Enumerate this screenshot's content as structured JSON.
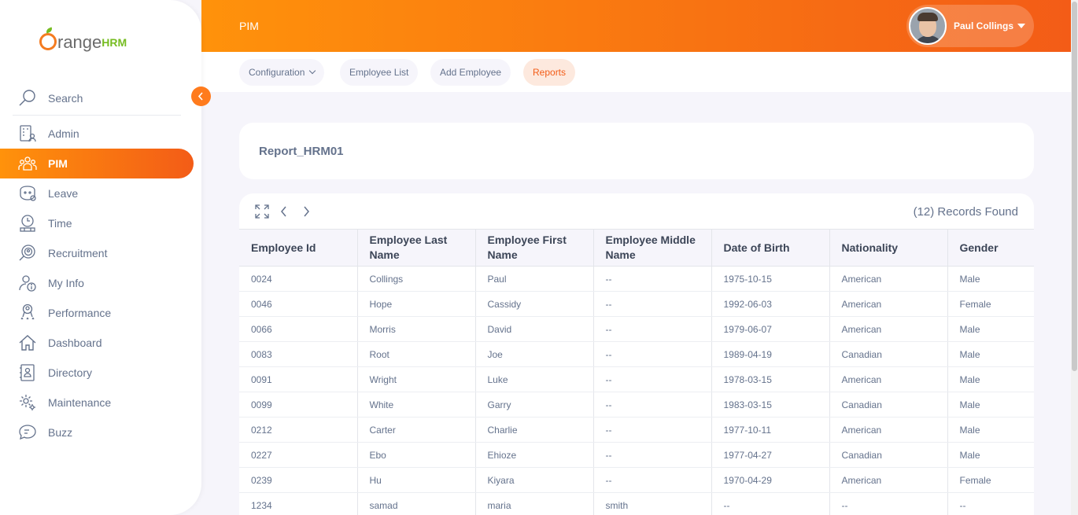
{
  "brand": {
    "part1": "range",
    "part2": "HRM"
  },
  "sidebar": {
    "search_label": "Search",
    "items": [
      {
        "label": "Admin",
        "icon": "admin-icon"
      },
      {
        "label": "PIM",
        "icon": "pim-icon",
        "active": true
      },
      {
        "label": "Leave",
        "icon": "leave-icon"
      },
      {
        "label": "Time",
        "icon": "time-icon"
      },
      {
        "label": "Recruitment",
        "icon": "recruitment-icon"
      },
      {
        "label": "My Info",
        "icon": "my-info-icon"
      },
      {
        "label": "Performance",
        "icon": "performance-icon"
      },
      {
        "label": "Dashboard",
        "icon": "dashboard-icon"
      },
      {
        "label": "Directory",
        "icon": "directory-icon"
      },
      {
        "label": "Maintenance",
        "icon": "maintenance-icon"
      },
      {
        "label": "Buzz",
        "icon": "buzz-icon"
      }
    ]
  },
  "header": {
    "module": "PIM",
    "user_name": "Paul Collings"
  },
  "subnav": {
    "tabs": [
      {
        "label": "Configuration"
      },
      {
        "label": "Employee List"
      },
      {
        "label": "Add Employee"
      },
      {
        "label": "Reports",
        "active": true
      }
    ]
  },
  "report": {
    "title": "Report_HRM01",
    "records_found": "(12) Records Found",
    "columns": [
      "Employee Id",
      "Employee Last Name",
      "Employee First Name",
      "Employee Middle Name",
      "Date of Birth",
      "Nationality",
      "Gender"
    ],
    "rows": [
      [
        "0024",
        "Collings",
        "Paul",
        "--",
        "1975-10-15",
        "American",
        "Male"
      ],
      [
        "0046",
        "Hope",
        "Cassidy",
        "--",
        "1992-06-03",
        "American",
        "Female"
      ],
      [
        "0066",
        "Morris",
        "David",
        "--",
        "1979-06-07",
        "American",
        "Male"
      ],
      [
        "0083",
        "Root",
        "Joe",
        "--",
        "1989-04-19",
        "Canadian",
        "Male"
      ],
      [
        "0091",
        "Wright",
        "Luke",
        "--",
        "1978-03-15",
        "American",
        "Male"
      ],
      [
        "0099",
        "White",
        "Garry",
        "--",
        "1983-03-15",
        "Canadian",
        "Male"
      ],
      [
        "0212",
        "Carter",
        "Charlie",
        "--",
        "1977-10-11",
        "American",
        "Male"
      ],
      [
        "0227",
        "Ebo",
        "Ehioze",
        "--",
        "1977-04-27",
        "Canadian",
        "Male"
      ],
      [
        "0239",
        "Hu",
        "Kiyara",
        "--",
        "1970-04-29",
        "American",
        "Female"
      ],
      [
        "1234",
        "samad",
        "maria",
        "smith",
        "--",
        "--",
        "--"
      ]
    ]
  },
  "colors": {
    "accent": "#ff7b1d",
    "accent_dark": "#f35c17",
    "text": "#64728c"
  }
}
